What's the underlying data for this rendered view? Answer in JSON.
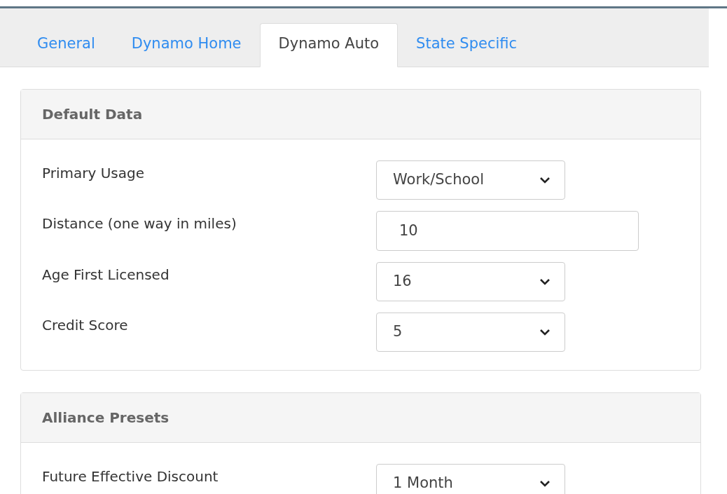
{
  "tabs": [
    {
      "label": "General",
      "selected": false
    },
    {
      "label": "Dynamo Home",
      "selected": false
    },
    {
      "label": "Dynamo Auto",
      "selected": true
    },
    {
      "label": "State Specific",
      "selected": false
    }
  ],
  "panels": [
    {
      "title": "Default Data",
      "fields": [
        {
          "label": "Primary Usage",
          "kind": "select",
          "value": "Work/School"
        },
        {
          "label": "Distance (one way in miles)",
          "kind": "text",
          "value": "10"
        },
        {
          "label": "Age First Licensed",
          "kind": "select",
          "value": "16"
        },
        {
          "label": "Credit Score",
          "kind": "select",
          "value": "5"
        }
      ]
    },
    {
      "title": "Alliance Presets",
      "fields": [
        {
          "label": "Future Effective Discount",
          "kind": "select",
          "value": "1 Month"
        }
      ]
    }
  ]
}
